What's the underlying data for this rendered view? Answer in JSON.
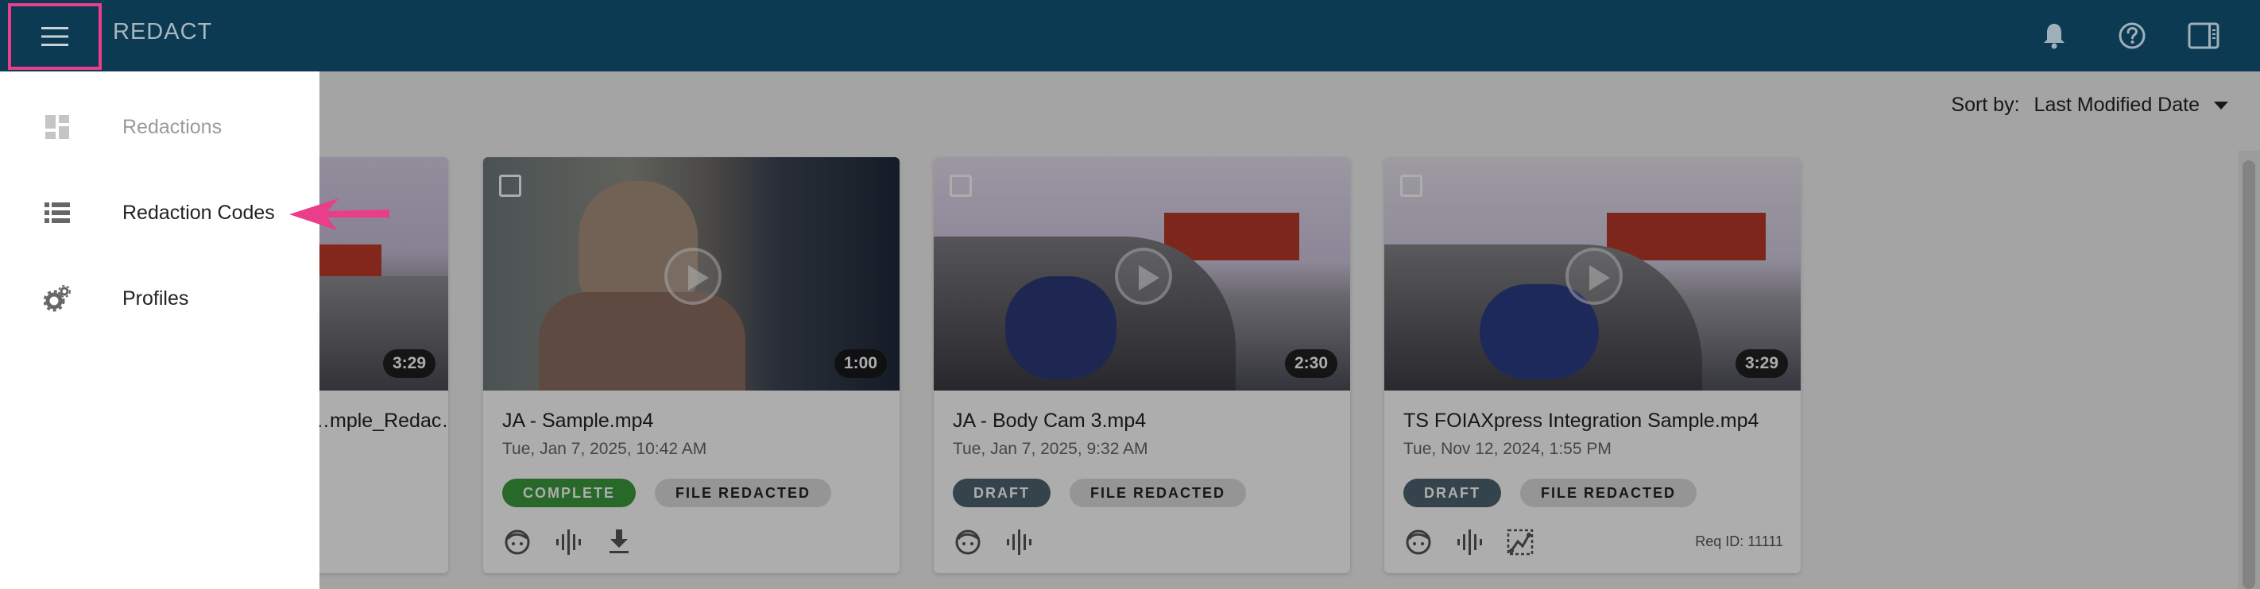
{
  "header": {
    "title": "REDACT",
    "menu_icon": "hamburger-menu-icon",
    "icons": [
      "bell-icon",
      "help-icon",
      "side-panel-icon"
    ]
  },
  "sort": {
    "label": "Sort by:",
    "value": "Last Modified Date"
  },
  "drawer": {
    "items": [
      {
        "label": "Redactions",
        "icon": "dashboard-icon",
        "disabled": true
      },
      {
        "label": "Redaction Codes",
        "icon": "list-icon",
        "disabled": false
      },
      {
        "label": "Profiles",
        "icon": "gears-icon",
        "disabled": false
      }
    ]
  },
  "cards": [
    {
      "name": "…mple_Redac…",
      "duration": "3:29"
    },
    {
      "name": "JA - Sample.mp4",
      "date": "Tue, Jan 7, 2025, 10:42 AM",
      "duration": "1:00",
      "status": "COMPLETE",
      "file_status": "FILE REDACTED"
    },
    {
      "name": "JA - Body Cam 3.mp4",
      "date": "Tue, Jan 7, 2025, 9:32 AM",
      "duration": "2:30",
      "status": "DRAFT",
      "file_status": "FILE REDACTED"
    },
    {
      "name": "TS FOIAXpress Integration Sample.mp4",
      "date": "Tue, Nov 12, 2024, 1:55 PM",
      "duration": "3:29",
      "status": "DRAFT",
      "file_status": "FILE REDACTED",
      "req_id": "Req ID: 11111"
    }
  ],
  "colors": {
    "appbar": "#0b3a52",
    "highlight": "#ea3d8a",
    "complete": "#3c9a3c",
    "draft": "#4f6470"
  }
}
